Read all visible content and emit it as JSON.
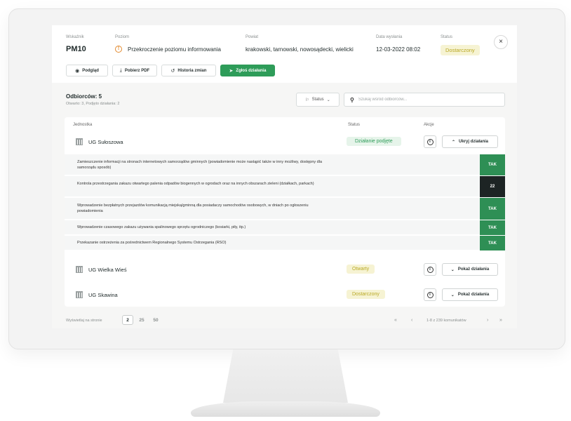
{
  "header": {
    "labels": {
      "indicator": "Wskaźnik",
      "level": "Poziom",
      "county": "Powiat",
      "sent_date": "Data wysłania",
      "status": "Status"
    },
    "indicator": "PM10",
    "level": "Przekroczenie poziomu informowania",
    "county": "krakowski, tarnowski, nowosądecki, wielicki",
    "sent_date": "12-03-2022 08:02",
    "status": "Dostarczony",
    "close": "×"
  },
  "toolbar": {
    "preview": "Podgląd",
    "pdf": "Pobierz PDF",
    "history": "Historia zmian",
    "report": "Zgłoś działania"
  },
  "recipients": {
    "title": "Odbiorców: 5",
    "subtitle": "Otwarto: 3, Podjęto działania: 2",
    "status_filter": "Status",
    "search_placeholder": "Szukaj wśród odbiorców..."
  },
  "table": {
    "headers": {
      "unit": "Jednostka",
      "status": "Status",
      "actions": "Akcje"
    },
    "rows": [
      {
        "name": "UG Sułoszowa",
        "status": "Działanie podjęte",
        "toggle": "Ukryj działania"
      },
      {
        "name": "UG Wielka Wieś",
        "status": "Otwarty",
        "toggle": "Pokaż działania"
      },
      {
        "name": "UG Skawina",
        "status": "Dostarczony",
        "toggle": "Pokaż działania"
      }
    ],
    "actions": [
      {
        "text": "Zamieszczenie informacji na stronach internetowych samorządów gminnych (powiadomienie może nastąpić także w inny możliwy, dostępny dla samorządu sposób)",
        "value": "TAK"
      },
      {
        "text": "Kontrola przestrzegania zakazu otwartego palenia odpadów biogennych w ogrodach oraz na innych obszarach zieleni (działkach, parkach)",
        "value": "22"
      },
      {
        "text": "Wprowadzenie bezpłatnych przejazdów komunikacją miejską/gminną dla posiadaczy samochodów osobowych, w dniach po ogłoszeniu powiadomienia",
        "value": "TAK"
      },
      {
        "text": "Wprowadzenie czasowego zakazu używania spalinowego sprzętu ogrodniczego (kosiarki, piły, itp.)",
        "value": "TAK"
      },
      {
        "text": "Przekazanie ostrzeżenia za pośrednictwem Regionalnego Systemu Ostrzegania (RSO)",
        "value": "TAK"
      }
    ]
  },
  "footer": {
    "per_page_label": "Wyświetlaj na stronie",
    "page_sizes": [
      "2",
      "25",
      "50"
    ],
    "pager_info": "1-8 z 239 komunikatów",
    "first": "«",
    "prev": "‹",
    "next": "›",
    "last": "»"
  },
  "colors": {
    "accent": "#2e9c59",
    "tak": "#2e8f55",
    "dark": "#1d2424",
    "warning": "#e38a2d"
  },
  "icons": [
    "eye-icon",
    "download-icon",
    "history-icon",
    "send-icon",
    "warning-icon",
    "close-icon",
    "flag-icon",
    "chevron-down-icon",
    "search-icon",
    "building-icon",
    "info-icon",
    "chevron-up-icon"
  ]
}
